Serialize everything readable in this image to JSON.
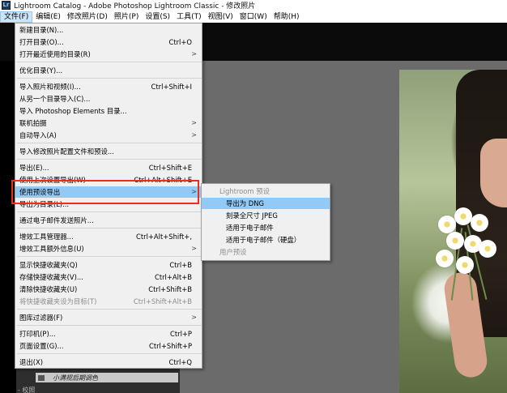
{
  "window": {
    "app_icon": "Lr",
    "title": "Lightroom Catalog - Adobe Photoshop Lightroom Classic - 修改照片"
  },
  "menubar": [
    {
      "label": "文件(F)"
    },
    {
      "label": "编辑(E)"
    },
    {
      "label": "修改照片(D)"
    },
    {
      "label": "照片(P)"
    },
    {
      "label": "设置(S)"
    },
    {
      "label": "工具(T)"
    },
    {
      "label": "视图(V)"
    },
    {
      "label": "窗口(W)"
    },
    {
      "label": "帮助(H)"
    }
  ],
  "file_menu": {
    "items": [
      {
        "label": "新建目录(N)...",
        "shortcut": ""
      },
      {
        "label": "打开目录(O)...",
        "shortcut": "Ctrl+O"
      },
      {
        "label": "打开最近使用的目录(R)",
        "shortcut": ""
      },
      {
        "label": "优化目录(Y)...",
        "shortcut": ""
      },
      {
        "label": "导入照片和视频(I)...",
        "shortcut": "Ctrl+Shift+I"
      },
      {
        "label": "从另一个目录导入(C)...",
        "shortcut": ""
      },
      {
        "label": "导入 Photoshop Elements 目录...",
        "shortcut": ""
      },
      {
        "label": "联机拍摄",
        "shortcut": ""
      },
      {
        "label": "自动导入(A)",
        "shortcut": ""
      },
      {
        "label": "导入修改照片配置文件和预设...",
        "shortcut": ""
      },
      {
        "label": "导出(E)...",
        "shortcut": "Ctrl+Shift+E"
      },
      {
        "label": "使用上次设置导出(W)",
        "shortcut": "Ctrl+Alt+Shift+E"
      },
      {
        "label": "使用预设导出",
        "shortcut": ""
      },
      {
        "label": "导出为目录(L)...",
        "shortcut": ""
      },
      {
        "label": "通过电子邮件发送照片...",
        "shortcut": ""
      },
      {
        "label": "增效工具管理器...",
        "shortcut": "Ctrl+Alt+Shift+,"
      },
      {
        "label": "增效工具额外信息(U)",
        "shortcut": ""
      },
      {
        "label": "显示快捷收藏夹(Q)",
        "shortcut": "Ctrl+B"
      },
      {
        "label": "存储快捷收藏夹(V)...",
        "shortcut": "Ctrl+Alt+B"
      },
      {
        "label": "清除快捷收藏夹(U)",
        "shortcut": "Ctrl+Shift+B"
      },
      {
        "label": "将快捷收藏夹设为目标(T)",
        "shortcut": "Ctrl+Shift+Alt+B"
      },
      {
        "label": "图库过滤器(F)",
        "shortcut": ""
      },
      {
        "label": "打印机(P)...",
        "shortcut": "Ctrl+P"
      },
      {
        "label": "页面设置(G)...",
        "shortcut": "Ctrl+Shift+P"
      },
      {
        "label": "退出(X)",
        "shortcut": "Ctrl+Q"
      }
    ]
  },
  "submenu": {
    "header": "Lightroom 预设",
    "items": [
      {
        "label": "导出为 DNG"
      },
      {
        "label": "刻录全尺寸 JPEG"
      },
      {
        "label": "适用于电子邮件"
      },
      {
        "label": "适用于电子邮件（硬盘）"
      }
    ],
    "footer": "用户预设"
  },
  "left_panel": {
    "collection_label": "小满视后期调色",
    "partial_label": "- 校照"
  },
  "colors": {
    "menu_highlight": "#91c9f7",
    "annotation_red": "#e8301c",
    "center_background": "#6b6b6b"
  },
  "icons": {
    "app": "lightroom-app-icon",
    "submenu_arrow": "chevron-right-icon",
    "collection": "collection-icon"
  }
}
